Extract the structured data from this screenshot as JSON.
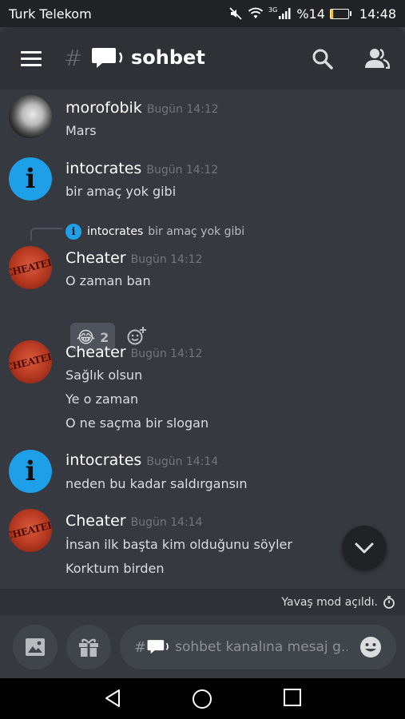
{
  "status_bar": {
    "carrier": "Turk Telekom",
    "network_type": "3G",
    "battery_text": "%14",
    "time": "14:48",
    "icons": [
      "mute-icon",
      "wifi-icon",
      "signal-icon",
      "battery-icon"
    ]
  },
  "header": {
    "hash": "#",
    "channel_name": "sohbet",
    "icons": [
      "menu-icon",
      "speech-bubble-icon",
      "search-icon",
      "members-icon"
    ]
  },
  "messages": [
    {
      "user": "morofobik",
      "time": "Bugün 14:12",
      "avatar": "photo",
      "lines": [
        "Mars"
      ]
    },
    {
      "user": "intocrates",
      "time": "Bugün 14:12",
      "avatar": "info-i",
      "lines": [
        "bir amaç yok gibi"
      ]
    },
    {
      "user": "Cheater",
      "time": "Bugün 14:12",
      "avatar": "cheater-stamp",
      "reply_to": {
        "user": "intocrates",
        "text": "bir amaç yok gibi"
      },
      "lines": [
        "O zaman ban"
      ],
      "reaction": {
        "emoji": "😂",
        "count": "2"
      }
    },
    {
      "user": "Cheater",
      "time": "Bugün 14:12",
      "avatar": "cheater-stamp",
      "lines": [
        "Sağlık olsun",
        "Ye o zaman",
        "O ne saçma bir slogan"
      ]
    },
    {
      "user": "intocrates",
      "time": "Bugün 14:14",
      "avatar": "info-i",
      "lines": [
        "neden bu kadar saldırgansın"
      ]
    },
    {
      "user": "Cheater",
      "time": "Bugün 14:14",
      "avatar": "cheater-stamp",
      "lines": [
        "İnsan ilk başta kim olduğunu söyler",
        "Korktum birden"
      ]
    }
  ],
  "avatar_text": {
    "info": "i",
    "cheater": "CHEATER"
  },
  "slowmode": {
    "text": "Yavaş mod açıldı."
  },
  "composer": {
    "hash": "#",
    "placeholder": "sohbet kanalına mesaj g..."
  },
  "colors": {
    "background": "#36393f",
    "header": "#2f3136",
    "input": "#40444b",
    "info_avatar": "#1ea0e8"
  }
}
